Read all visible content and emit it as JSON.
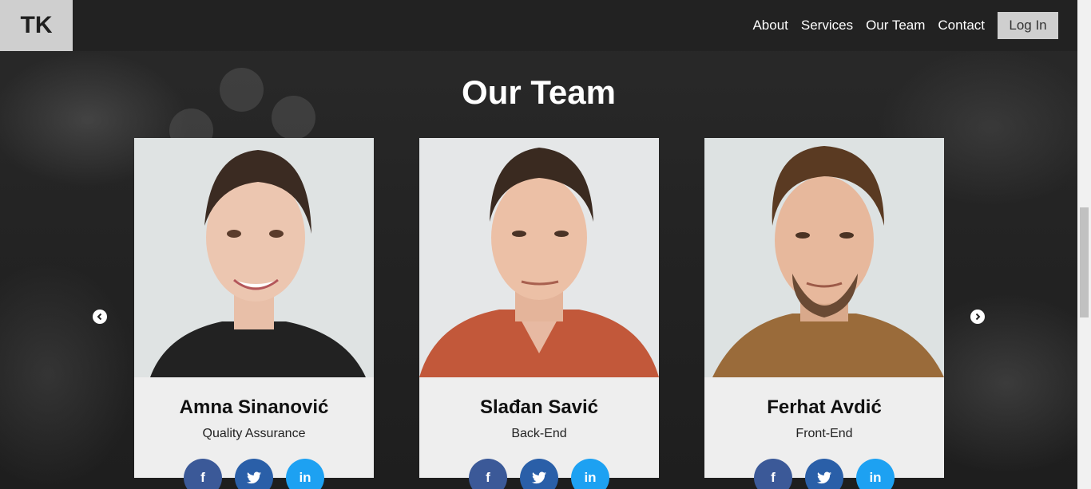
{
  "brand": {
    "logo_text": "TK"
  },
  "nav": {
    "links": [
      "About",
      "Services",
      "Our Team",
      "Contact"
    ],
    "login_label": "Log In"
  },
  "section": {
    "title": "Our Team"
  },
  "team": [
    {
      "name": "Amna Sinanović",
      "role": "Quality Assurance"
    },
    {
      "name": "Slađan Savić",
      "role": "Back-End"
    },
    {
      "name": "Ferhat Avdić",
      "role": "Front-End"
    }
  ],
  "social_icons": {
    "facebook": "f",
    "twitter": "twitter-bird-icon",
    "linkedin": "in"
  },
  "colors": {
    "facebook": "#3b5998",
    "twitter": "#2a5fa8",
    "linkedin": "#1da1f2",
    "navbar": "#222222",
    "card": "#eeeeee"
  }
}
